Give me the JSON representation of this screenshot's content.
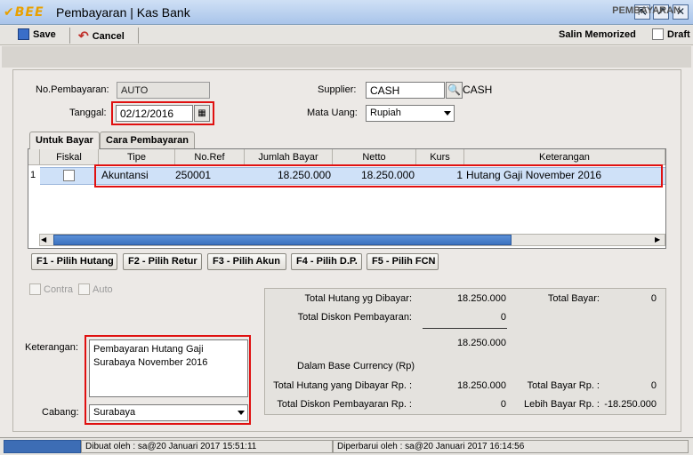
{
  "window": {
    "logo": "BEE",
    "title": "Pembayaran | Kas Bank"
  },
  "toolbar": {
    "save_label": "Save",
    "cancel_label": "Cancel",
    "memorized_label": "Salin Memorized",
    "draft_label": "Draft"
  },
  "section_title": "PEMBAYARAN",
  "form": {
    "no_pembayaran_label": "No.Pembayaran:",
    "no_pembayaran_value": "AUTO",
    "tanggal_label": "Tanggal:",
    "tanggal_value": "02/12/2016",
    "supplier_label": "Supplier:",
    "supplier_code": "CASH",
    "supplier_name": "CASH",
    "mata_uang_label": "Mata Uang:",
    "mata_uang_value": "Rupiah"
  },
  "tabs": [
    {
      "label": "Untuk Bayar"
    },
    {
      "label": "Cara Pembayaran"
    }
  ],
  "grid": {
    "columns": [
      "Fiskal",
      "Tipe",
      "No.Ref",
      "Jumlah Bayar",
      "Netto",
      "Kurs",
      "Keterangan"
    ],
    "rows": [
      {
        "num": "1",
        "tipe": "Akuntansi",
        "noref": "250001",
        "jumlah": "18.250.000",
        "netto": "18.250.000",
        "kurs": "1",
        "keterangan": "Hutang Gaji November 2016"
      }
    ]
  },
  "fkeys": [
    "F1 - Pilih Hutang",
    "F2 - Pilih Retur",
    "F3 - Pilih Akun",
    "F4 - Pilih D.P.",
    "F5 - Pilih FCN"
  ],
  "options": {
    "contra_label": "Contra",
    "auto_label": "Auto"
  },
  "keterangan": {
    "label": "Keterangan:",
    "line1": "Pembayaran Hutang Gaji",
    "line2": "Surabaya November 2016"
  },
  "cabang": {
    "label": "Cabang:",
    "value": "Surabaya"
  },
  "summary": {
    "total_hutang_label": "Total Hutang yg Dibayar:",
    "total_hutang_value": "18.250.000",
    "total_bayar_label": "Total Bayar:",
    "total_bayar_value": "0",
    "total_diskon_label": "Total Diskon Pembayaran:",
    "total_diskon_value": "0",
    "subtotal_value": "18.250.000",
    "base_currency_label": "Dalam Base Currency (Rp)",
    "total_hutang_rp_label": "Total Hutang yang Dibayar Rp. :",
    "total_hutang_rp_value": "18.250.000",
    "total_bayar_rp_label": "Total Bayar Rp. :",
    "total_bayar_rp_value": "0",
    "total_diskon_rp_label": "Total Diskon Pembayaran Rp. :",
    "total_diskon_rp_value": "0",
    "lebih_bayar_rp_label": "Lebih Bayar Rp. :",
    "lebih_bayar_rp_value": "-18.250.000"
  },
  "status": {
    "created": "Dibuat oleh : sa@20 Januari 2017  15:51:11",
    "updated": "Diperbarui oleh : sa@20 Januari 2017  16:14:56"
  }
}
